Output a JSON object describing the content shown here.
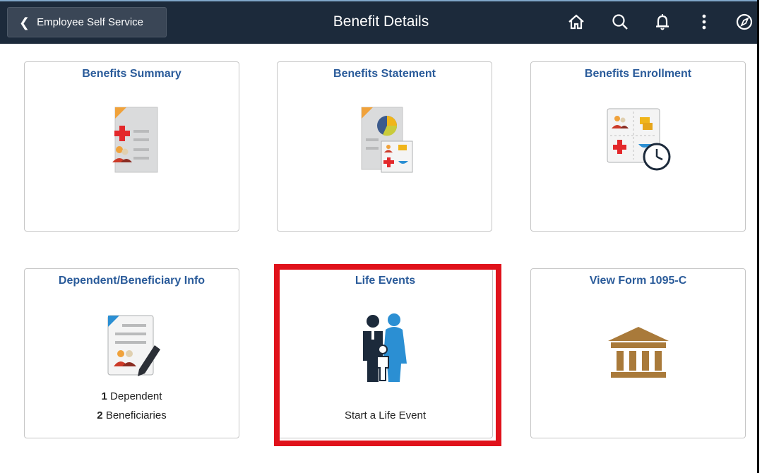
{
  "header": {
    "back_label": "Employee Self Service",
    "title": "Benefit Details",
    "icons": [
      "home-icon",
      "search-icon",
      "notifications-icon",
      "actions-menu-icon",
      "navbar-icon"
    ]
  },
  "tiles": [
    {
      "title": "Benefits Summary",
      "icon": "benefits-summary-icon"
    },
    {
      "title": "Benefits Statement",
      "icon": "benefits-statement-icon"
    },
    {
      "title": "Benefits Enrollment",
      "icon": "benefits-enrollment-icon"
    },
    {
      "title": "Dependent/Beneficiary Info",
      "icon": "dependent-beneficiary-icon",
      "line1_count": "1",
      "line1_label": "Dependent",
      "line2_count": "2",
      "line2_label": "Beneficiaries"
    },
    {
      "title": "Life Events",
      "icon": "family-icon",
      "subtitle": "Start a Life Event",
      "highlighted": true
    },
    {
      "title": "View Form 1095-C",
      "icon": "building-icon"
    }
  ],
  "colors": {
    "header_bg": "#1c2a3b",
    "tile_title": "#2a5b9a",
    "highlight_border": "#e0121b"
  }
}
